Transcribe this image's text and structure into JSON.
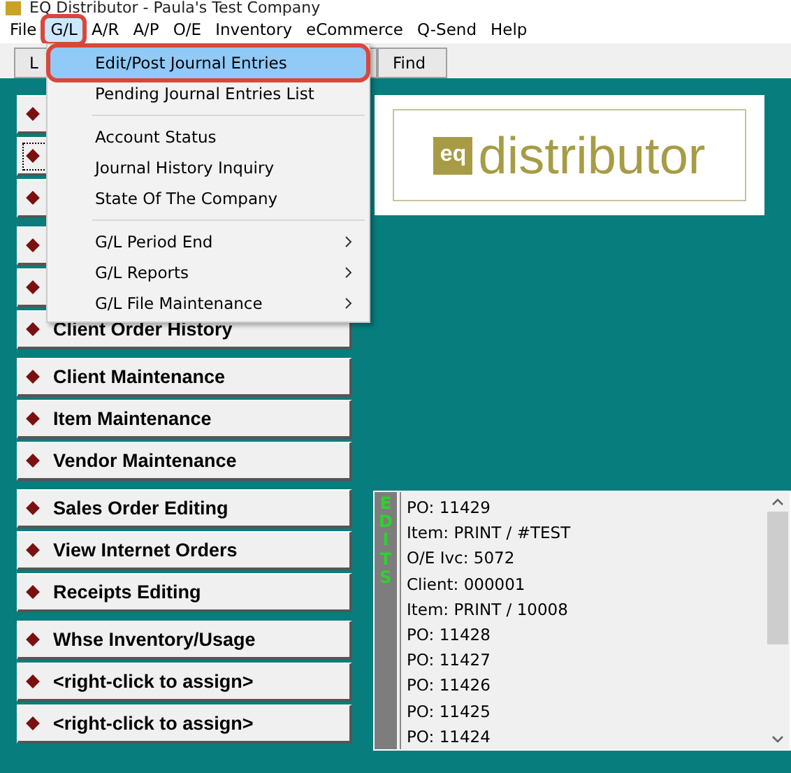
{
  "window": {
    "title": "EQ Distributor - Paula's Test Company"
  },
  "menu_bar": [
    {
      "label": "File",
      "selected": false
    },
    {
      "label": "G/L",
      "selected": true
    },
    {
      "label": "A/R",
      "selected": false
    },
    {
      "label": "A/P",
      "selected": false
    },
    {
      "label": "O/E",
      "selected": false
    },
    {
      "label": "Inventory",
      "selected": false
    },
    {
      "label": "eCommerce",
      "selected": false
    },
    {
      "label": "Q-Send",
      "selected": false
    },
    {
      "label": "Help",
      "selected": false
    }
  ],
  "toolbar": [
    {
      "label": "L"
    },
    {
      "label": "Find"
    }
  ],
  "dropdown": {
    "groups": [
      [
        {
          "label": "Edit/Post Journal Entries",
          "selected": true,
          "submenu": false
        },
        {
          "label": "Pending Journal Entries List",
          "selected": false,
          "submenu": false
        }
      ],
      [
        {
          "label": "Account Status",
          "selected": false,
          "submenu": false
        },
        {
          "label": "Journal History Inquiry",
          "selected": false,
          "submenu": false
        },
        {
          "label": "State Of The Company",
          "selected": false,
          "submenu": false
        }
      ],
      [
        {
          "label": "G/L Period End",
          "selected": false,
          "submenu": true
        },
        {
          "label": "G/L Reports",
          "selected": false,
          "submenu": true
        },
        {
          "label": "G/L File Maintenance",
          "selected": false,
          "submenu": true
        }
      ]
    ]
  },
  "button_groups": [
    {
      "buttons": [
        {
          "focused": false
        },
        {
          "focused": true
        },
        {
          "focused": false
        }
      ]
    },
    {
      "buttons": [
        {
          "focused": false
        },
        {
          "focused": false
        },
        {
          "label": "Client Order History",
          "focused": false
        }
      ]
    },
    {
      "buttons": [
        {
          "label": "Client Maintenance",
          "focused": false
        },
        {
          "label": "Item Maintenance",
          "focused": false
        },
        {
          "label": "Vendor Maintenance",
          "focused": false
        }
      ]
    },
    {
      "buttons": [
        {
          "label": "Sales Order Editing",
          "focused": false
        },
        {
          "label": "View Internet Orders",
          "focused": false
        },
        {
          "label": "Receipts Editing",
          "focused": false
        }
      ]
    },
    {
      "buttons": [
        {
          "label": "Whse Inventory/Usage",
          "focused": false
        },
        {
          "label": "<right-click to assign>",
          "focused": false
        },
        {
          "label": "<right-click to assign>",
          "focused": false
        }
      ]
    }
  ],
  "logo": {
    "mark": "eq",
    "text": "distributor"
  },
  "edits_panel": {
    "label": "EDITS",
    "entries": [
      "PO: 11429",
      "Item: PRINT / #TEST",
      "O/E Ivc: 5072",
      "Client: 000001",
      "Item: PRINT / 10008",
      "PO: 11428",
      "PO: 11427",
      "PO: 11426",
      "PO: 11425",
      "PO: 11424"
    ]
  }
}
